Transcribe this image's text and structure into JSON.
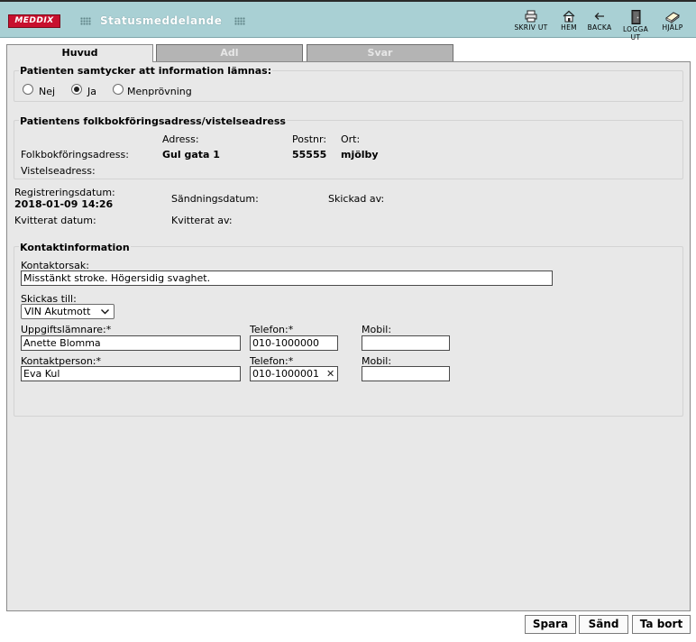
{
  "header": {
    "logo_text": "MEDDIX",
    "title": "Statusmeddelande",
    "toolbar": [
      {
        "label": "SKRIV UT",
        "icon": "printer-icon"
      },
      {
        "label": "HEM",
        "icon": "home-icon"
      },
      {
        "label": "BACKA",
        "icon": "back-arrow-icon"
      },
      {
        "label": "LOGGA UT",
        "icon": "logout-door-icon"
      },
      {
        "label": "HJÄLP",
        "icon": "help-book-icon"
      }
    ]
  },
  "tabs": [
    {
      "label": "Huvud",
      "active": true
    },
    {
      "label": "Adl",
      "active": false
    },
    {
      "label": "Svar",
      "active": false
    }
  ],
  "consent": {
    "legend": "Patienten samtycker att information lämnas:",
    "options": [
      {
        "label": "Nej",
        "checked": false
      },
      {
        "label": "Ja",
        "checked": true
      },
      {
        "label": "Menprövning",
        "checked": false
      }
    ]
  },
  "address": {
    "legend": "Patientens folkbokföringsadress/vistelseadress",
    "col_address": "Adress:",
    "col_postnr": "Postnr:",
    "col_ort": "Ort:",
    "folkbok_label": "Folkbokföringsadress:",
    "folkbok_address": "Gul gata 1",
    "folkbok_postnr": "55555",
    "folkbok_ort": "mjölby",
    "vistelse_label": "Vistelseadress:"
  },
  "registration": {
    "reg_label": "Registreringsdatum:",
    "reg_value": "2018-01-09 14:26",
    "send_label": "Sändningsdatum:",
    "sent_by_label": "Skickad av:",
    "ack_date_label": "Kvitterat datum:",
    "ack_by_label": "Kvitterat av:"
  },
  "contact": {
    "legend": "Kontaktinformation",
    "reason_label": "Kontaktorsak:",
    "reason_value": "Misstänkt stroke. Högersidig svaghet.",
    "send_to_label": "Skickas till:",
    "send_to_value": "VIN Akutmott",
    "informant_label": "Uppgiftslämnare:*",
    "informant_value": "Anette Blomma",
    "phone1_label": "Telefon:*",
    "phone1_value": "010-1000000",
    "mobile1_label": "Mobil:",
    "mobile1_value": "",
    "contact_person_label": "Kontaktperson:*",
    "contact_person_value": "Eva Kul",
    "phone2_label": "Telefon:*",
    "phone2_value": "010-1000001",
    "mobile2_label": "Mobil:",
    "mobile2_value": ""
  },
  "buttons": {
    "save": "Spara",
    "send": "Sänd",
    "delete": "Ta bort"
  },
  "colors": {
    "header_bg": "#a9d0d4",
    "logo_red": "#c8102e",
    "panel_bg": "#e8e8e8",
    "inactive_tab": "#b4b4b4"
  }
}
